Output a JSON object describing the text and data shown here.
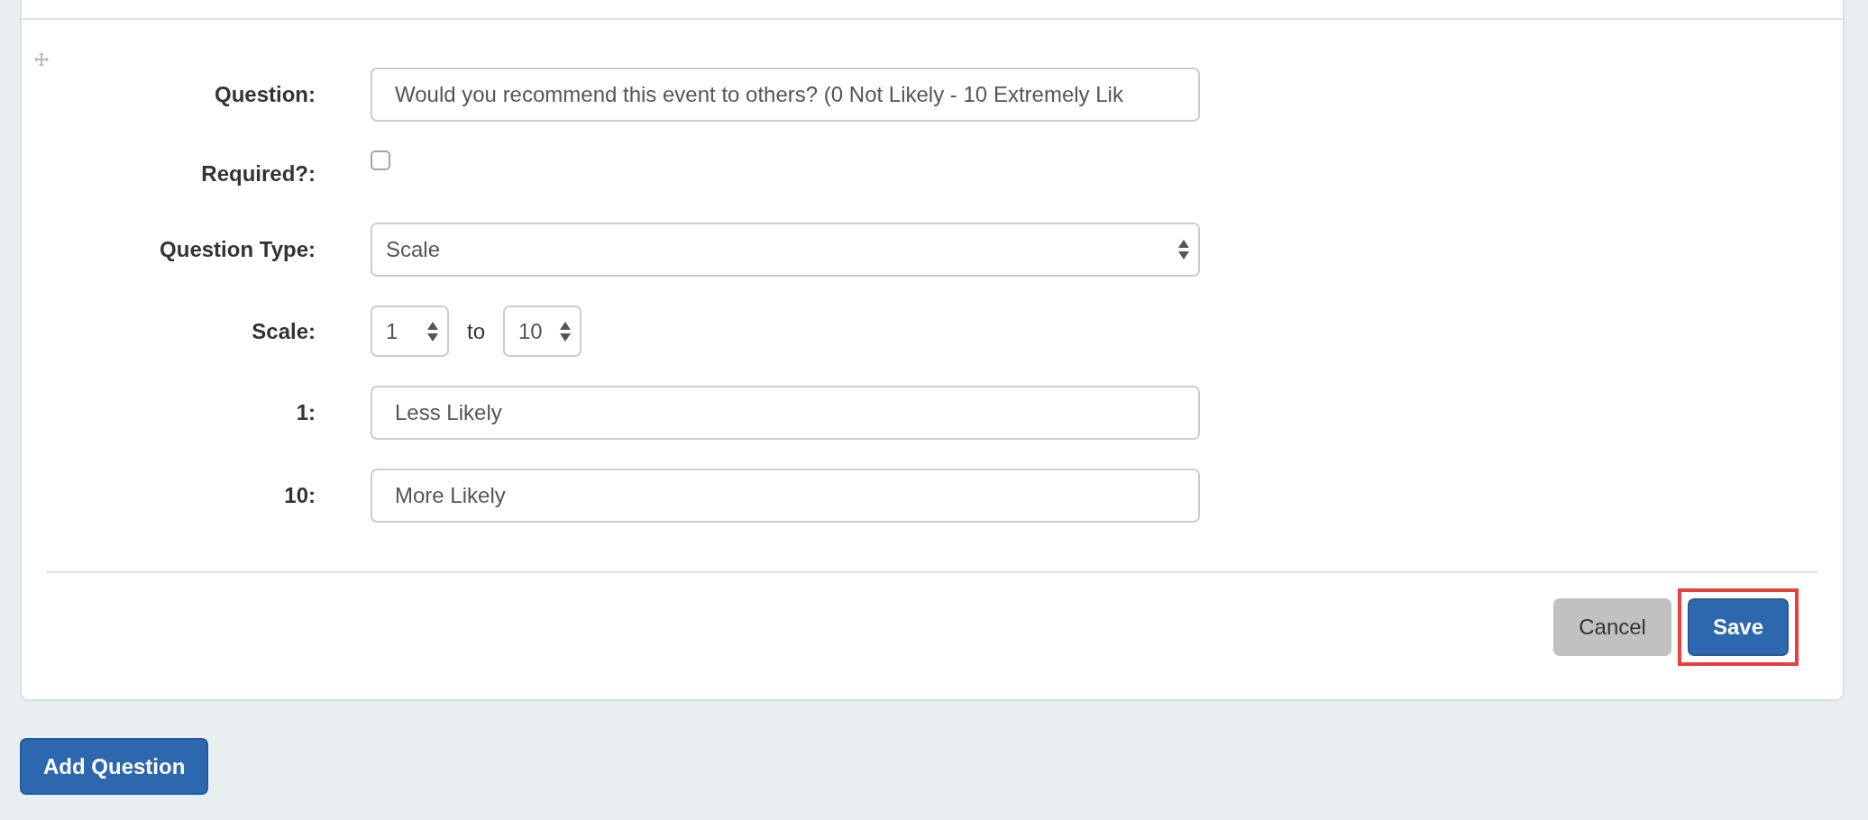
{
  "form": {
    "fields": [
      {
        "kind": "text",
        "label": "Question:",
        "value": "Would you recommend this event to others? (0 Not Likely - 10 Extremely Lik"
      },
      {
        "kind": "checkbox",
        "label": "Required?:",
        "checked": false
      },
      {
        "kind": "select",
        "label": "Question Type:",
        "value": "Scale"
      },
      {
        "kind": "range",
        "label": "Scale:",
        "from": "1",
        "joiner": "to",
        "to": "10"
      },
      {
        "kind": "text",
        "label": "1:",
        "value": "Less Likely"
      },
      {
        "kind": "text",
        "label": "10:",
        "value": "More Likely"
      }
    ]
  },
  "footer": {
    "buttons": [
      {
        "kind": "cancel",
        "label": "Cancel",
        "highlighted": false
      },
      {
        "kind": "save",
        "label": "Save",
        "highlighted": true
      }
    ]
  },
  "add_button": {
    "label": "Add Question"
  }
}
